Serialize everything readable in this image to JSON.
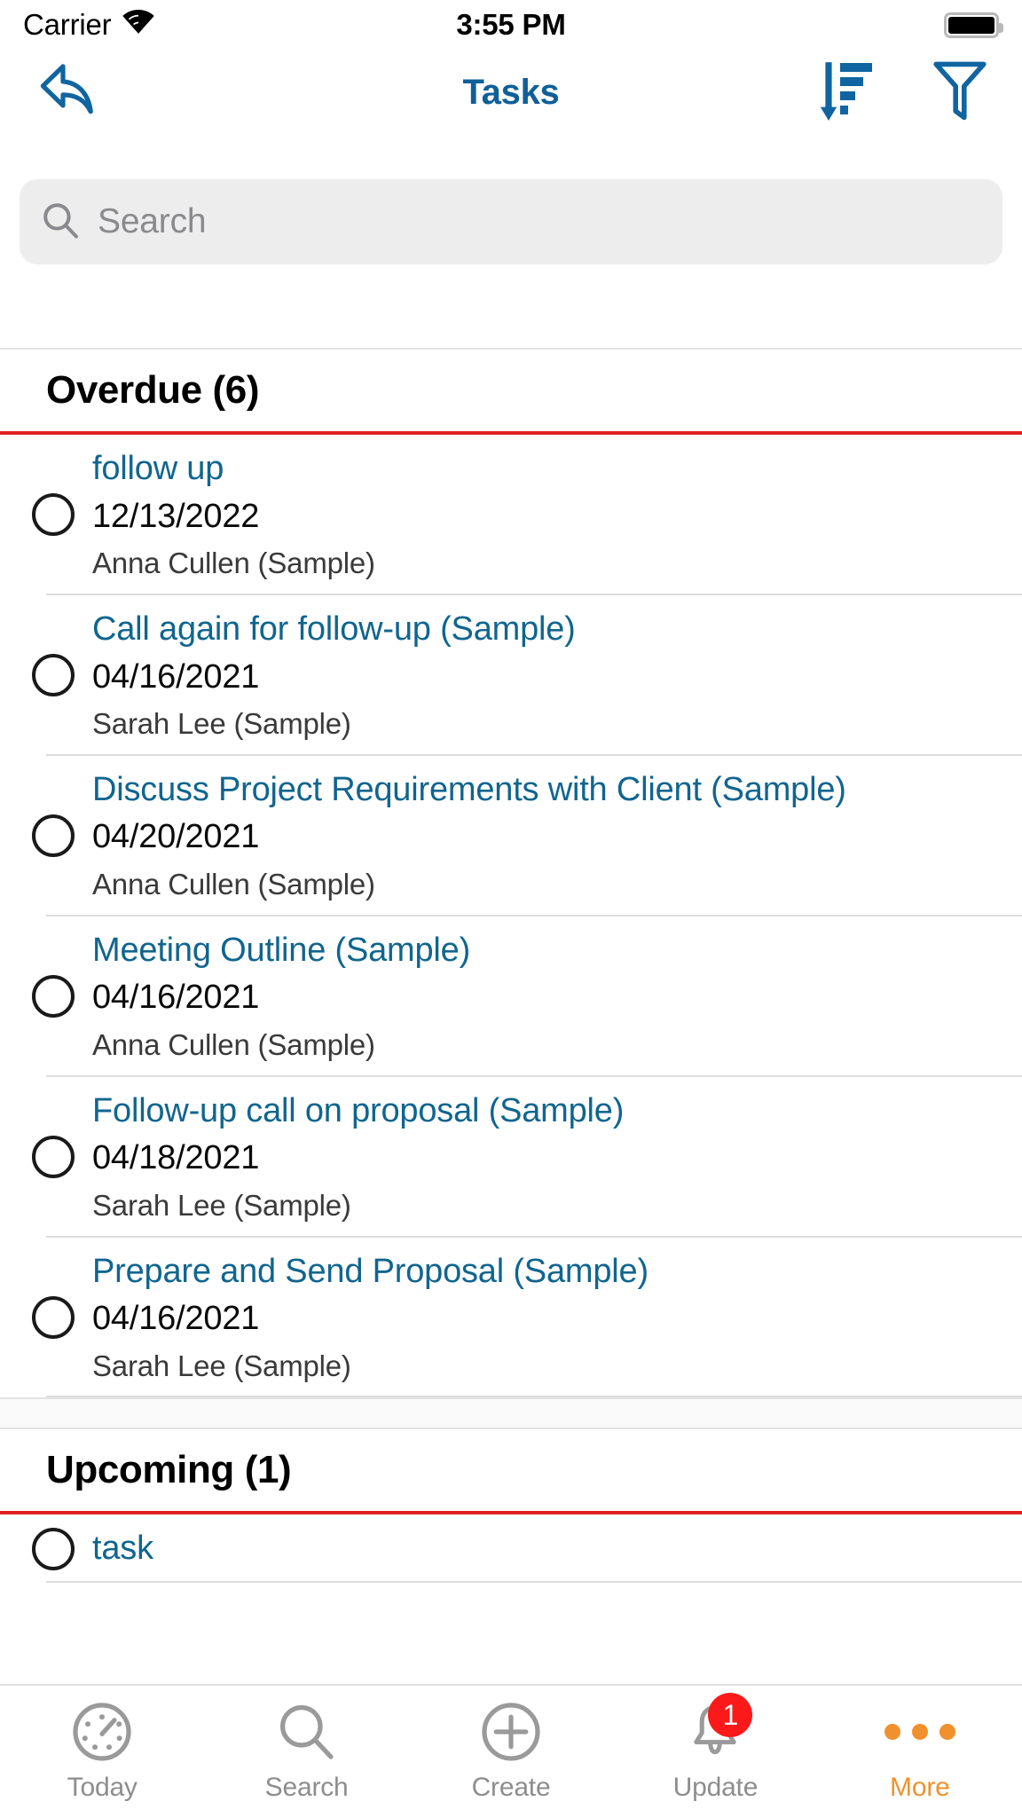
{
  "status_bar": {
    "carrier": "Carrier",
    "time": "3:55 PM",
    "wifi_icon": "wifi-icon",
    "battery_icon": "battery-full-icon"
  },
  "nav": {
    "back_icon": "back-reply-arrow-icon",
    "title": "Tasks",
    "sort_icon": "sort-descending-icon",
    "filter_icon": "filter-funnel-icon"
  },
  "search": {
    "icon": "search-icon",
    "placeholder": "Search",
    "value": ""
  },
  "sections": [
    {
      "title": "Overdue (6)",
      "accent": "#e02020",
      "tasks": [
        {
          "title": "follow up",
          "date": "12/13/2022",
          "contact": "Anna Cullen (Sample)"
        },
        {
          "title": "Call again for follow-up (Sample)",
          "date": "04/16/2021",
          "contact": "Sarah Lee (Sample)"
        },
        {
          "title": "Discuss Project Requirements with Client (Sample)",
          "date": "04/20/2021",
          "contact": "Anna Cullen (Sample)"
        },
        {
          "title": "Meeting Outline (Sample)",
          "date": "04/16/2021",
          "contact": "Anna Cullen (Sample)"
        },
        {
          "title": "Follow-up call on proposal (Sample)",
          "date": "04/18/2021",
          "contact": "Sarah Lee (Sample)"
        },
        {
          "title": "Prepare and Send Proposal (Sample)",
          "date": "04/16/2021",
          "contact": "Sarah Lee (Sample)"
        }
      ]
    },
    {
      "title": "Upcoming (1)",
      "accent": "#e02020",
      "tasks": [
        {
          "title": "task",
          "date": "",
          "contact": ""
        }
      ]
    }
  ],
  "tabbar": {
    "items": [
      {
        "label": "Today",
        "icon": "speedometer-icon",
        "badge": "",
        "active": false
      },
      {
        "label": "Search",
        "icon": "search-icon",
        "badge": "",
        "active": false
      },
      {
        "label": "Create",
        "icon": "plus-circle-icon",
        "badge": "",
        "active": false
      },
      {
        "label": "Update",
        "icon": "bell-icon",
        "badge": "1",
        "active": false
      },
      {
        "label": "More",
        "icon": "ellipsis-icon",
        "badge": "",
        "active": true
      }
    ]
  },
  "colors": {
    "brand_blue": "#10658f",
    "nav_blue": "#0f6099",
    "overdue_red": "#e02020",
    "badge_red": "#fb1919",
    "accent_orange": "#f0912d",
    "search_bg": "#ededed"
  }
}
